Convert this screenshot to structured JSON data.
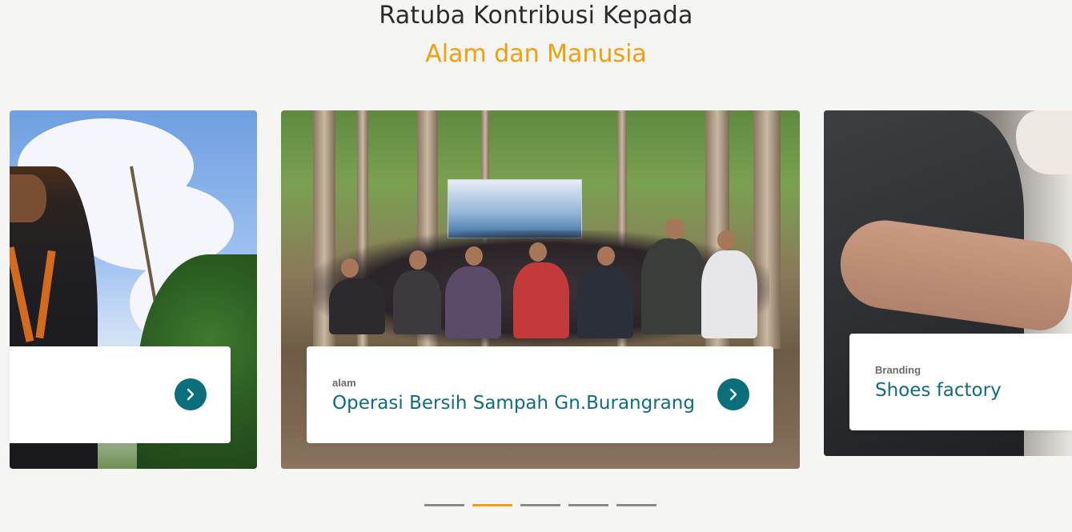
{
  "heading": {
    "line1": "Ratuba Kontribusi Kepada",
    "line2": "Alam dan Manusia"
  },
  "colors": {
    "accent": "#f59e0b",
    "title_teal": "#0f6e7d",
    "button_teal": "#0b6e7b",
    "background": "#f5f5f4"
  },
  "slides": [
    {
      "category": "",
      "title": "",
      "icon": "chevron-right-icon"
    },
    {
      "category": "alam",
      "title": "Operasi Bersih Sampah Gn.Burangrang",
      "icon": "chevron-right-icon"
    },
    {
      "category": "Branding",
      "title": "Shoes factory"
    }
  ],
  "pagination": {
    "count": 5,
    "active_index": 1
  }
}
